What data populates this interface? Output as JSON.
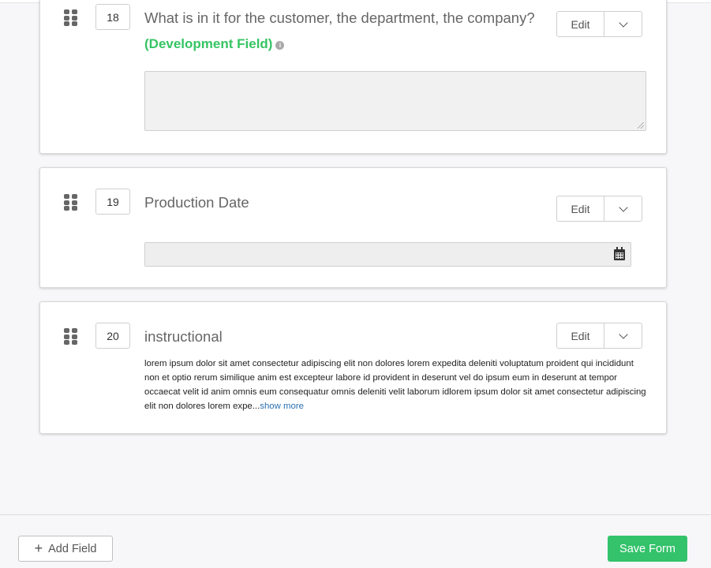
{
  "fields": [
    {
      "number": "18",
      "title": "What is in it for the customer, the department, the company?",
      "tag": "(Development Field)",
      "tag_info_icon": "info-icon",
      "edit_label": "Edit",
      "input_type": "textarea",
      "value": ""
    },
    {
      "number": "19",
      "title": "Production Date",
      "edit_label": "Edit",
      "input_type": "date",
      "value": "",
      "icon": "calendar-icon"
    },
    {
      "number": "20",
      "title": "instructional",
      "edit_label": "Edit",
      "input_type": "text",
      "body": "lorem ipsum dolor sit amet consectetur adipiscing elit non dolores lorem expedita deleniti voluptatum proident qui incididunt non et optio rerum similique anim est excepteur labore id provident in deserunt vel do ipsum eum in deserunt at tempor occaecat velit id anim omnis eum consequatur omnis deleniti velit laborum idlorem ipsum dolor sit amet consectetur adipiscing elit non dolores lorem expe...",
      "show_more_label": "show more"
    }
  ],
  "footer": {
    "add_field_label": "Add Field",
    "add_field_icon": "plus-icon",
    "save_form_label": "Save Form"
  },
  "colors": {
    "accent_green": "#34c26b",
    "dev_field_green": "#36c463",
    "link_blue": "#2a6fb0"
  }
}
